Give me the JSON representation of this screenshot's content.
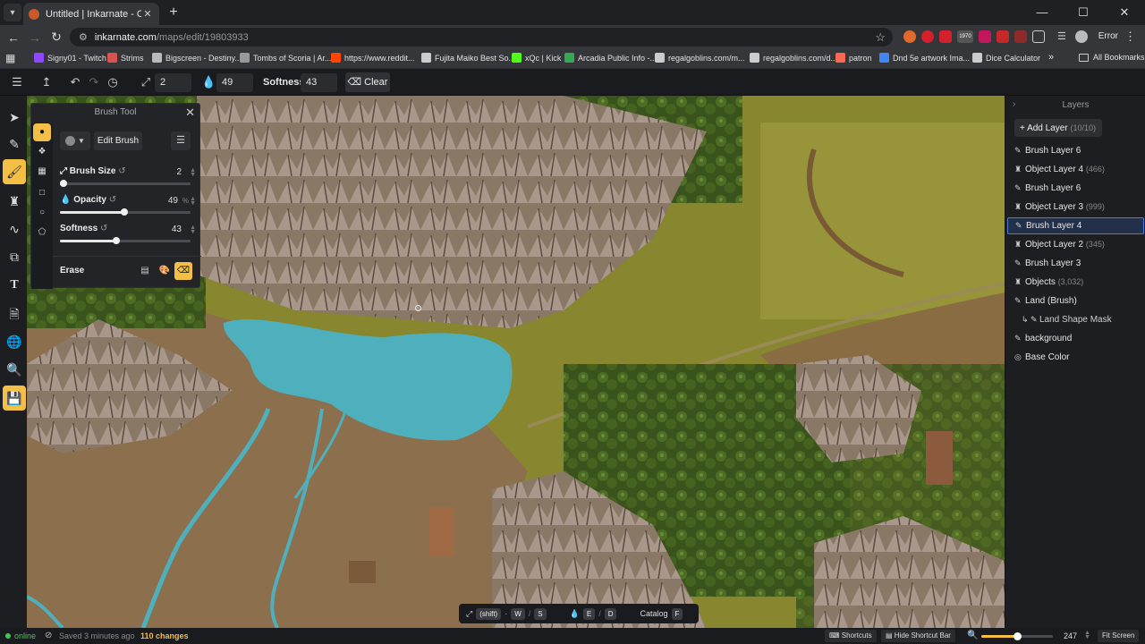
{
  "browser": {
    "tab_title": "Untitled | Inkarnate - Create Fa",
    "url_host": "inkarnate.com",
    "url_path": "/maps/edit/19803933",
    "profile_label": "Error",
    "ext_badge": "1970",
    "bookmarks": [
      {
        "label": "Signy01 - Twitch",
        "color": "#9146ff"
      },
      {
        "label": "Strims",
        "color": "#d9534f"
      },
      {
        "label": "Bigscreen - Destiny...",
        "color": "#bbbbbb"
      },
      {
        "label": "Tombs of Scoria | Ar...",
        "color": "#999999"
      },
      {
        "label": "https://www.reddit...",
        "color": "#ff4500"
      },
      {
        "label": "Fujita Maiko Best So...",
        "color": "#cccccc"
      },
      {
        "label": "xQc | Kick",
        "color": "#53fc18"
      },
      {
        "label": "Arcadia Public Info -...",
        "color": "#34a853"
      },
      {
        "label": "regalgoblins.com/m...",
        "color": "#cccccc"
      },
      {
        "label": "regalgoblins.com/d...",
        "color": "#cccccc"
      },
      {
        "label": "patron",
        "color": "#f96854"
      },
      {
        "label": "Dnd 5e artwork Ima...",
        "color": "#4285f4"
      },
      {
        "label": "Dice Calculator",
        "color": "#cccccc"
      }
    ],
    "all_bookmarks": "All Bookmarks"
  },
  "toolbar": {
    "size_value": "2",
    "opacity_value": "49",
    "softness_label": "Softness:",
    "softness_value": "43",
    "clear_label": "Clear"
  },
  "brush_panel": {
    "title": "Brush Tool",
    "edit_brush": "Edit Brush",
    "size_label": "Brush Size",
    "size_value": "2",
    "size_fraction": 0.03,
    "opacity_label": "Opacity",
    "opacity_value": "49",
    "opacity_unit": "%",
    "opacity_fraction": 0.49,
    "softness_label": "Softness",
    "softness_value": "43",
    "softness_fraction": 0.43,
    "erase_label": "Erase"
  },
  "layers_panel": {
    "title": "Layers",
    "add_layer": "Add Layer",
    "add_layer_count": "(10/10)",
    "items": [
      {
        "name": "Brush Layer 6",
        "count": "",
        "icon": "brush-icon",
        "selected": false,
        "sub": false
      },
      {
        "name": "Object Layer 4",
        "count": "(466)",
        "icon": "tower-icon",
        "selected": false,
        "sub": false
      },
      {
        "name": "Brush Layer 6",
        "count": "",
        "icon": "brush-icon",
        "selected": false,
        "sub": false
      },
      {
        "name": "Object Layer 3",
        "count": "(999)",
        "icon": "tower-icon",
        "selected": false,
        "sub": false
      },
      {
        "name": "Brush Layer 4",
        "count": "",
        "icon": "brush-icon",
        "selected": true,
        "sub": false
      },
      {
        "name": "Object Layer 2",
        "count": "(345)",
        "icon": "tower-icon",
        "selected": false,
        "sub": false
      },
      {
        "name": "Brush Layer 3",
        "count": "",
        "icon": "brush-icon",
        "selected": false,
        "sub": false
      },
      {
        "name": "Objects",
        "count": "(3,032)",
        "icon": "tower-icon",
        "selected": false,
        "sub": false
      },
      {
        "name": "Land (Brush)",
        "count": "",
        "icon": "brush-icon",
        "selected": false,
        "sub": false
      },
      {
        "name": "Land Shape Mask",
        "count": "",
        "icon": "mask-icon",
        "selected": false,
        "sub": true
      },
      {
        "name": "background",
        "count": "",
        "icon": "brush-icon",
        "selected": false,
        "sub": false
      },
      {
        "name": "Base Color",
        "count": "",
        "icon": "palette-icon",
        "selected": false,
        "sub": false
      }
    ]
  },
  "shortcut_bar": {
    "shift": "(shift)",
    "key_w": "W",
    "key_s": "S",
    "key_e": "E",
    "key_d": "D",
    "catalog": "Catalog",
    "key_f": "F"
  },
  "status_bar": {
    "online": "online",
    "saved": "Saved 3 minutes ago",
    "changes": "110 changes",
    "shortcuts": "Shortcuts",
    "hide_shortcut_bar": "Hide Shortcut Bar",
    "zoom_value": "247",
    "zoom_fraction": 0.5,
    "fit_screen": "Fit Screen"
  },
  "colors": {
    "accent": "#f4bf45",
    "selection": "#4a7bd4",
    "water": "#4fb0bd",
    "grass": "#8a8a34",
    "forest": "#3f5a1f"
  }
}
